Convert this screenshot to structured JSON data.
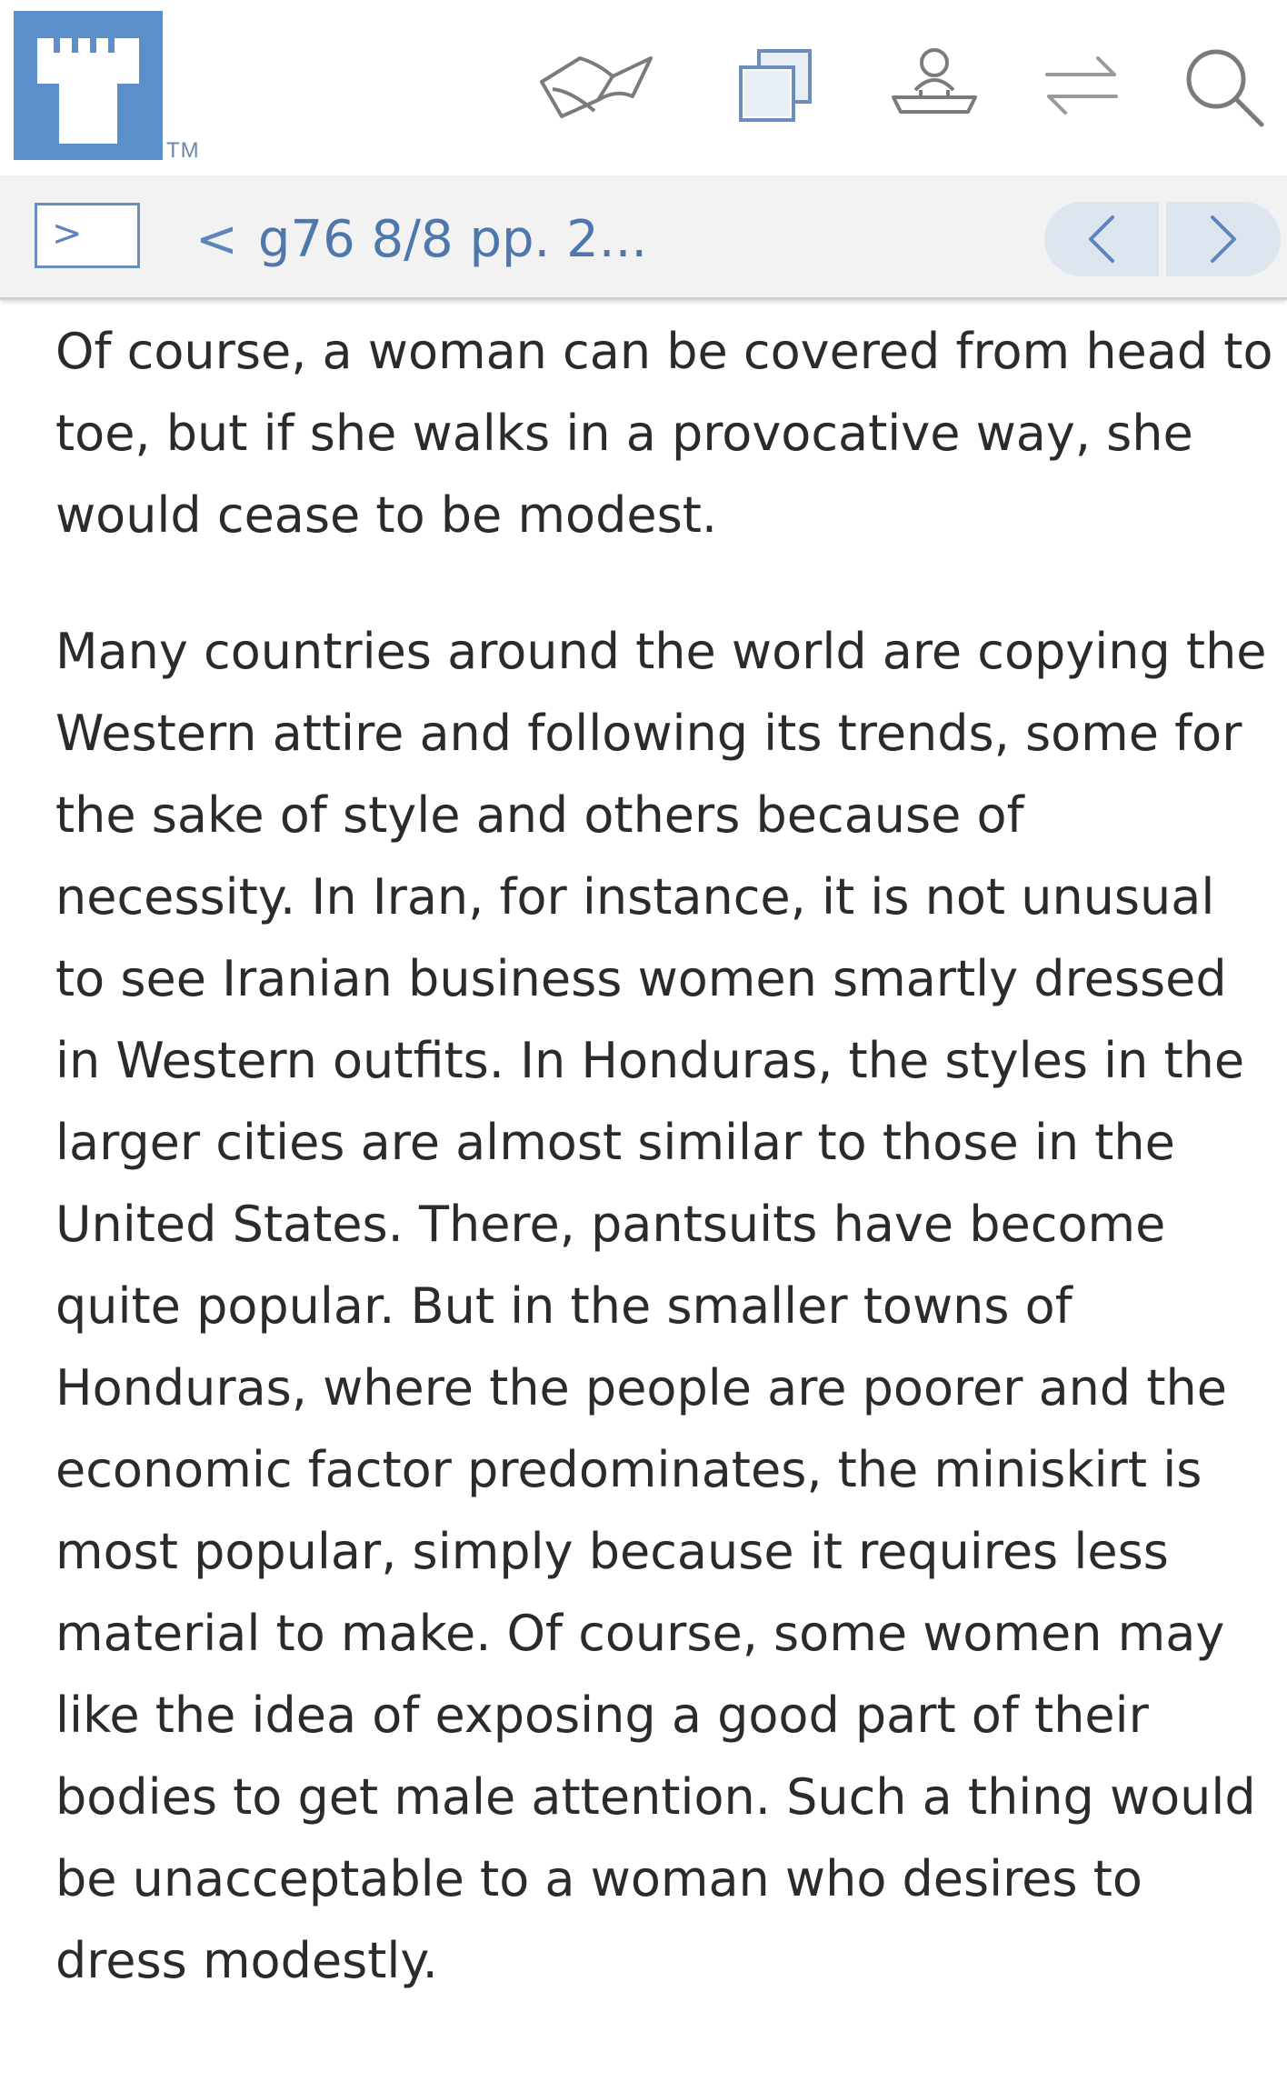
{
  "header": {
    "logo_mark": "TM",
    "icons": [
      "logo-tower-icon",
      "book-icon",
      "copy-icon",
      "person-icon",
      "swap-arrows-icon",
      "search-icon"
    ]
  },
  "nav": {
    "sidebar_toggle_label": ">",
    "breadcrumb": "g76 8/8 pp. 2...",
    "breadcrumb_chevron": "<",
    "prev_label": "<",
    "next_label": ">"
  },
  "article": {
    "paragraphs": [
      "Of course, a woman can be covered from head to toe, but if she walks in a provocative way, she would cease to be modest.",
      "Many countries around the world are copying the Western attire and following its trends, some for the sake of style and others because of necessity. In Iran, for instance, it is not unusual to see Iranian business women smartly dressed in Western outfits. In Honduras, the styles in the larger cities are almost similar to those in the United States. There, pantsuits have become quite popular. But in the smaller towns of Honduras, where the people are poorer and the economic factor predominates, the miniskirt is most popular, simply because it requires less material to make. Of course, some women may like the idea of exposing a good part of their bodies to get male attention. Such a thing would be unacceptable to a woman who desires to dress modestly."
    ]
  },
  "colors": {
    "logo_blue": "#5b8fc9",
    "link_blue": "#4d77ad",
    "nav_bg": "#f2f2f2",
    "pager_bg": "#dde5ee"
  }
}
